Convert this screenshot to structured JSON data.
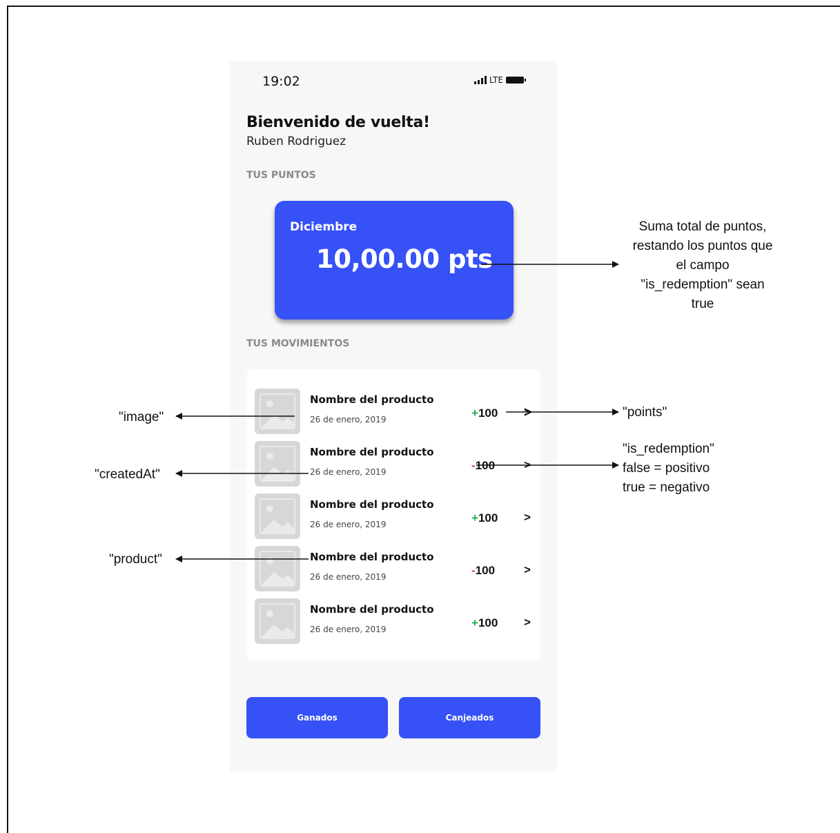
{
  "phone": {
    "status_time": "19:02",
    "network_label": "LTE",
    "welcome_title": "Bienvenido de vuelta!",
    "user_name": "Ruben Rodriguez",
    "points_section_label": "TUS PUNTOS",
    "points_card": {
      "month": "Diciembre",
      "points": "10,00.00 pts"
    },
    "movements_section_label": "TUS MOVIMIENTOS",
    "movements": [
      {
        "product": "Nombre del producto",
        "date": "26 de enero, 2019",
        "sign": "+",
        "amount": "100",
        "chevron": ">"
      },
      {
        "product": "Nombre del producto",
        "date": "26 de enero, 2019",
        "sign": "-",
        "amount": "100",
        "chevron": ">"
      },
      {
        "product": "Nombre del producto",
        "date": "26 de enero, 2019",
        "sign": "+",
        "amount": "100",
        "chevron": ">"
      },
      {
        "product": "Nombre del producto",
        "date": "26 de enero, 2019",
        "sign": "-",
        "amount": "100",
        "chevron": ">"
      },
      {
        "product": "Nombre del producto",
        "date": "26 de enero, 2019",
        "sign": "+",
        "amount": "100",
        "chevron": ">"
      }
    ],
    "buttons": {
      "earned": "Ganados",
      "redeemed": "Canjeados"
    }
  },
  "annotations": {
    "total_points": [
      "Suma total de puntos,",
      "restando los puntos que",
      "el campo",
      "\"is_redemption\" sean",
      "true"
    ],
    "points": "\"points\"",
    "is_redemption": [
      "\"is_redemption\"",
      "false = positivo",
      "true = negativo"
    ],
    "image": "\"image\"",
    "created_at": "\"createdAt\"",
    "product": "\"product\""
  },
  "colors": {
    "primary": "#3651f6",
    "positive": "#22b14c",
    "negative": "#e03131",
    "background": "#f7f7f7"
  }
}
